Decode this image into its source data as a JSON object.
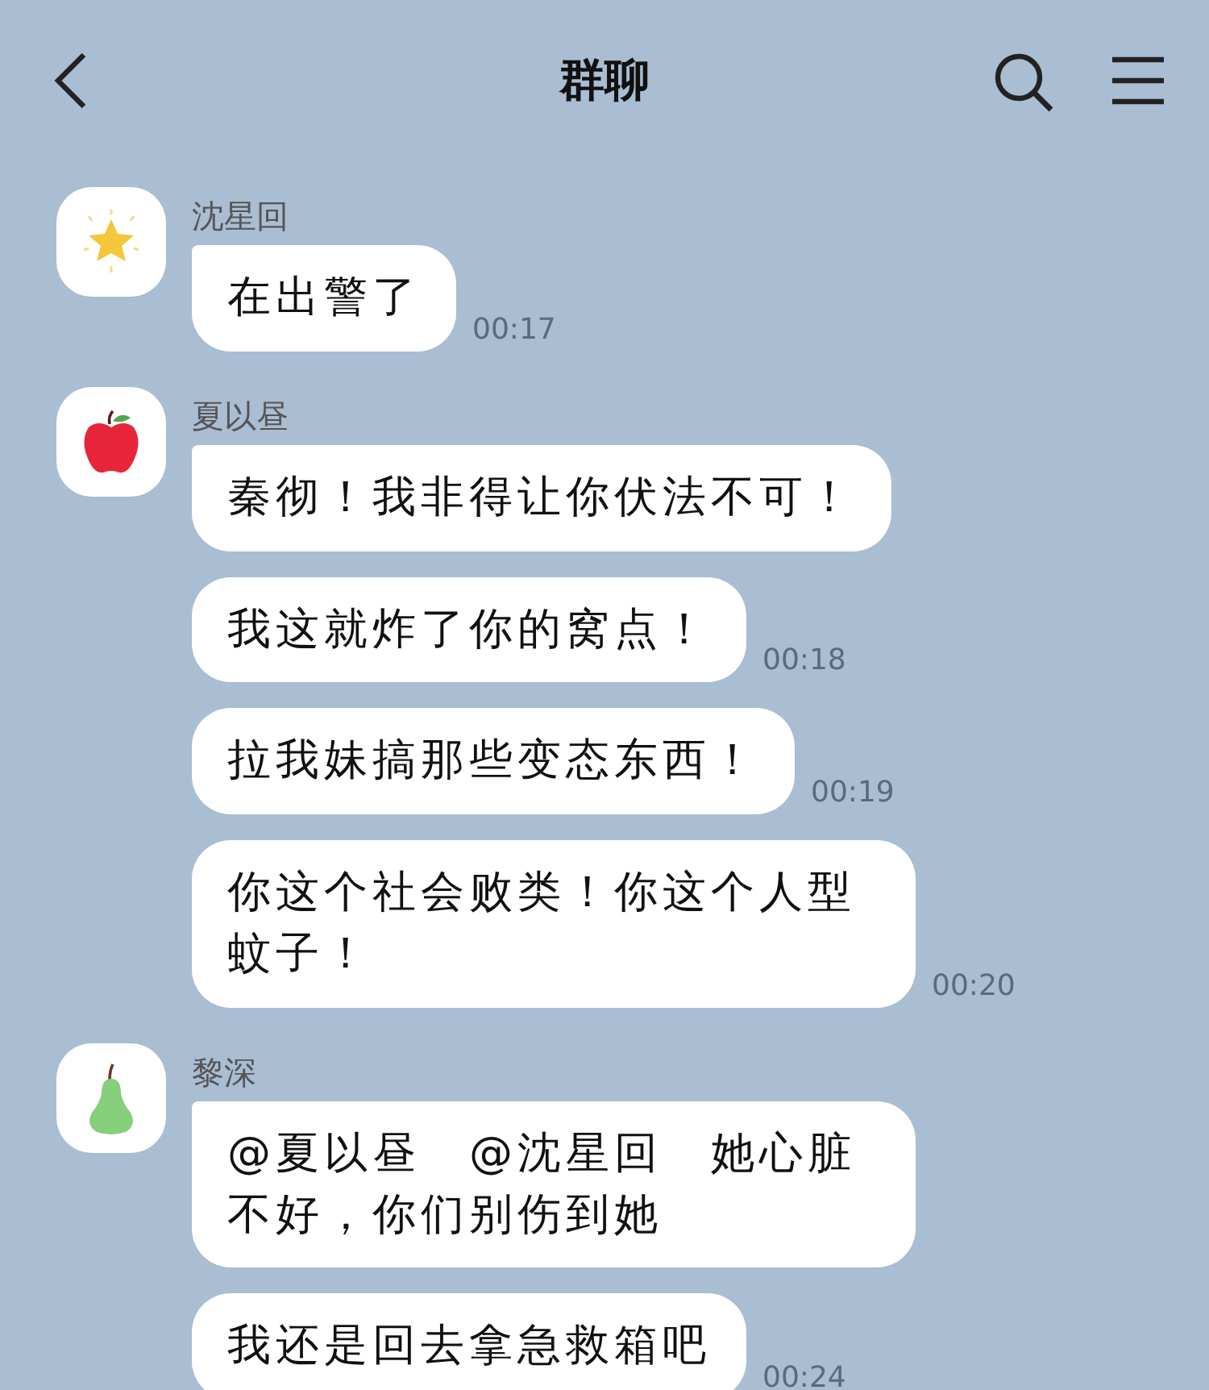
{
  "header": {
    "title": "群聊"
  },
  "groups": [
    {
      "sender": "沈星回",
      "avatar": {
        "kind": "star"
      },
      "messages": [
        {
          "text": "在出警了",
          "time": "00:17"
        }
      ]
    },
    {
      "sender": "夏以昼",
      "avatar": {
        "kind": "apple"
      },
      "messages": [
        {
          "text": "秦彻！我非得让你伏法不可！"
        },
        {
          "text": "我这就炸了你的窝点！",
          "time": "00:18"
        },
        {
          "text": "拉我妹搞那些变态东西！",
          "time": "00:19"
        },
        {
          "text": "你这个社会败类！你这个人型蚊子！",
          "time": "00:20"
        }
      ]
    },
    {
      "sender": "黎深",
      "avatar": {
        "kind": "pear"
      },
      "messages": [
        {
          "text": "@夏以昼　@沈星回　她心脏不好，你们别伤到她"
        },
        {
          "text": "我还是回去拿急救箱吧",
          "time": "00:24"
        }
      ]
    }
  ]
}
